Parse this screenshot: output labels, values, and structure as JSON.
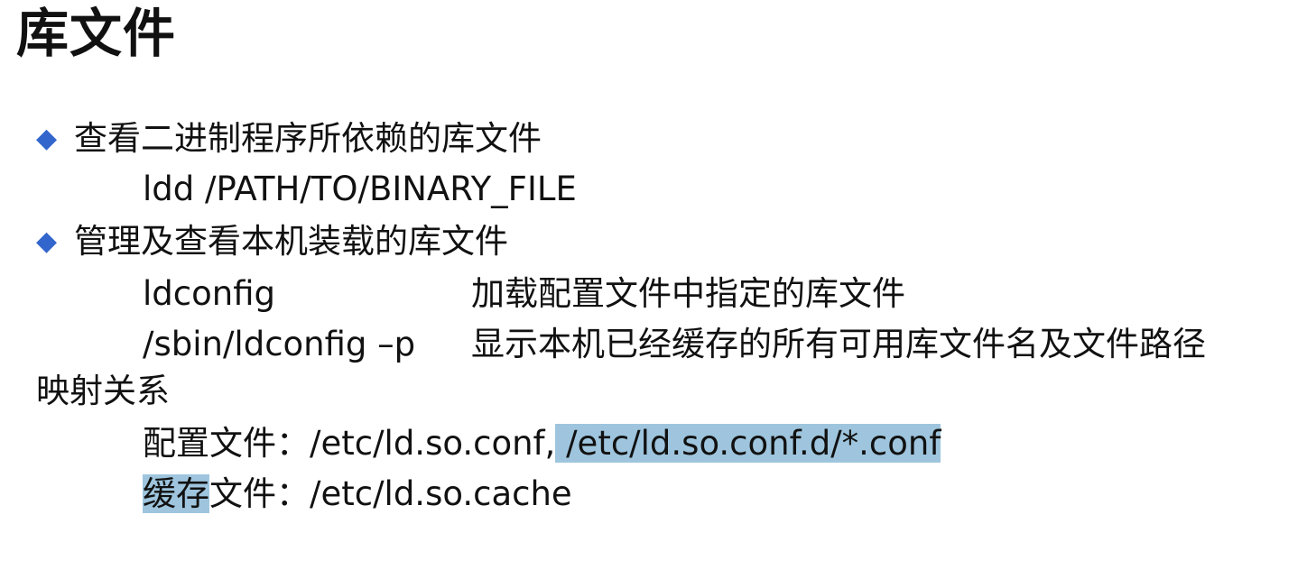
{
  "title": "库文件",
  "bullet1": {
    "glyph": "◆",
    "text": "查看二进制程序所依赖的库文件",
    "command": "ldd /PATH/TO/BINARY_FILE"
  },
  "bullet2": {
    "glyph": "◆",
    "text": "管理及查看本机装载的库文件",
    "rows": [
      {
        "cmd": "ldconfig",
        "desc": "加载配置文件中指定的库文件"
      },
      {
        "cmd": "/sbin/ldconfig –p",
        "desc": "显示本机已经缓存的所有可用库文件名及文件路径"
      }
    ],
    "wrap": "映射关系"
  },
  "config": {
    "label": "配置文件：/etc/ld.so.conf,",
    "highlighted": " /etc/ld.so.conf.d/*.conf"
  },
  "cache": {
    "highlighted": "缓存",
    "rest": "文件：/etc/ld.so.cache"
  },
  "colors": {
    "bullet": "#3366cc",
    "highlight": "#9ec5dd"
  }
}
